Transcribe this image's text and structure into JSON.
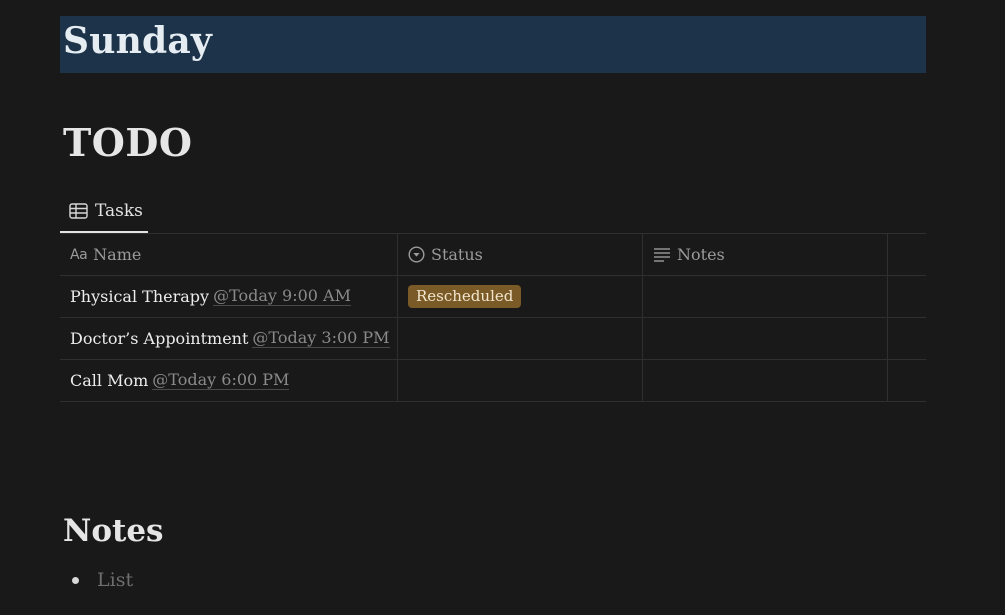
{
  "page": {
    "day_title": "Sunday",
    "todo_heading": "TODO",
    "notes_heading": "Notes"
  },
  "view_tabs": [
    {
      "label": "Tasks",
      "icon": "table-icon",
      "active": true
    }
  ],
  "table": {
    "columns": [
      {
        "label": "Name",
        "icon": "text-property-icon"
      },
      {
        "label": "Status",
        "icon": "status-property-icon"
      },
      {
        "label": "Notes",
        "icon": "lines-property-icon"
      }
    ],
    "rows": [
      {
        "name": "Physical Therapy",
        "date_mention": "@Today 9:00 AM",
        "status": "Rescheduled",
        "notes": ""
      },
      {
        "name": "Doctor’s Appointment",
        "date_mention": "@Today 3:00 PM",
        "status": "",
        "notes": ""
      },
      {
        "name": "Call Mom",
        "date_mention": "@Today 6:00 PM",
        "status": "",
        "notes": ""
      }
    ]
  },
  "notes_list": {
    "placeholder": "List"
  },
  "colors": {
    "background": "#191919",
    "banner": "#1d3349",
    "status_rescheduled": "#7a5a26"
  }
}
